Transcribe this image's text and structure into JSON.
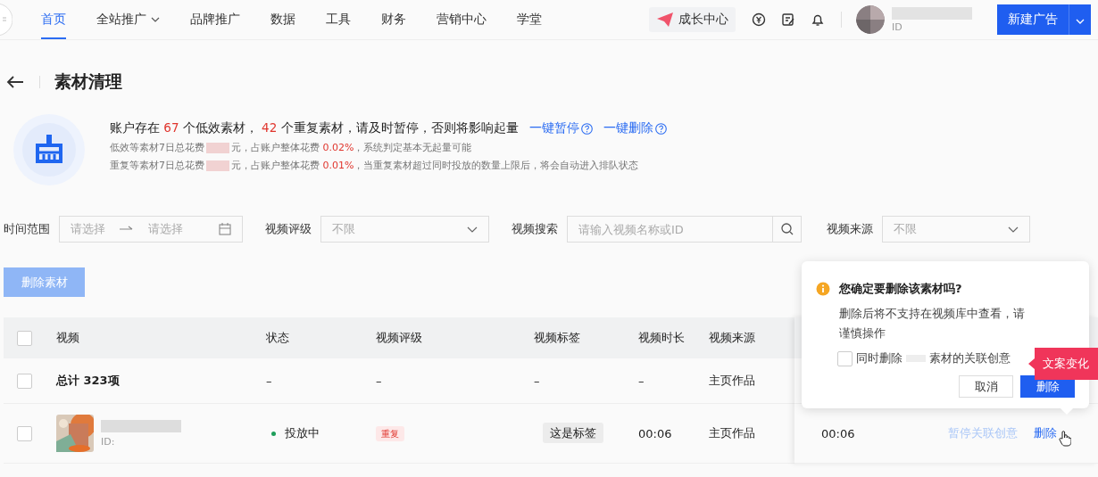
{
  "nav": {
    "items": [
      {
        "label": "首页",
        "selected": true,
        "dropdown": false
      },
      {
        "label": "全站推广",
        "selected": false,
        "dropdown": true
      },
      {
        "label": "品牌推广",
        "selected": false,
        "dropdown": false
      },
      {
        "label": "数据",
        "selected": false,
        "dropdown": false
      },
      {
        "label": "工具",
        "selected": false,
        "dropdown": false
      },
      {
        "label": "财务",
        "selected": false,
        "dropdown": false
      },
      {
        "label": "营销中心",
        "selected": false,
        "dropdown": false
      },
      {
        "label": "学堂",
        "selected": false,
        "dropdown": false
      }
    ],
    "growth_center": "成长中心",
    "account": {
      "id_label": "ID"
    },
    "new_ad_button": "新建广告"
  },
  "page": {
    "title": "素材清理"
  },
  "summary": {
    "headline": "账户存在 **67** 个低效素材， **42** 个重复素材，请及时暂停，否则将影响起量",
    "actions": [
      "一键暂停",
      "一键删除"
    ],
    "lines": [
      [
        "低效等素材7日总花费",
        "元，占账户整体花费 **0.02%**，系统判定基本无起量可能"
      ],
      [
        "重复等素材7日总花费",
        "元，占账户整体花费 **0.01%**，当重复素材超过同时投放的数量上限后，将会自动进入排队状态"
      ]
    ]
  },
  "filters": [
    {
      "kind": "daterange",
      "label": "时间范围",
      "placeholders": [
        "请选择",
        "请选择"
      ]
    },
    {
      "kind": "select",
      "label": "视频评级",
      "placeholder": "不限"
    },
    {
      "kind": "search",
      "label": "视频搜索",
      "placeholder": "请输入视频名称或ID"
    },
    {
      "kind": "select",
      "label": "视频来源",
      "placeholder": "不限"
    }
  ],
  "delete_button": {
    "label": "删除素材",
    "disabled": true
  },
  "table": {
    "select_all_checked": false,
    "columns": [
      "视频",
      "状态",
      "视频评级",
      "视频标签",
      "视频时长",
      "视频来源"
    ],
    "rows": [
      {
        "kind": "total",
        "checked": false,
        "cells": [
          "总计 323项",
          "–",
          "–",
          "–",
          "–",
          "主页作品"
        ]
      },
      {
        "kind": "video",
        "checked": false,
        "id": "ID:",
        "status": "投放中",
        "color": "#1e9e5a",
        "rating": "重复",
        "tag": "这是标签",
        "duration": "00:06",
        "source": "主页作品",
        "fixed_duration": "00:06",
        "actions": [
          {
            "label": "暂停关联创意",
            "disabled": true
          },
          {
            "label": "删除",
            "disabled": false
          }
        ]
      }
    ]
  },
  "popconfirm": {
    "title": "您确定要删除该素材吗?",
    "message": "删除后将不支持在视频库中查看，请谨慎操作",
    "checkbox": {
      "label_parts": [
        "同时删除",
        "素材的关联创意"
      ],
      "checked": false
    },
    "buttons": [
      {
        "label": "取消",
        "kind": "secondary"
      },
      {
        "label": "删除",
        "kind": "primary"
      }
    ]
  },
  "tooltip": "文案变化"
}
